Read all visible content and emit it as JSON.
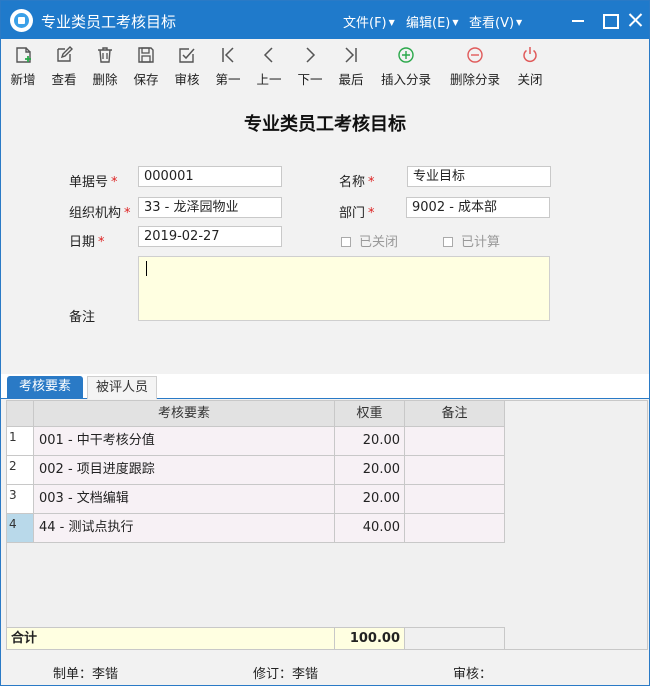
{
  "window": {
    "title": "专业类员工考核目标"
  },
  "menus": [
    {
      "label": "文件(F)"
    },
    {
      "label": "编辑(E)"
    },
    {
      "label": "查看(V)"
    }
  ],
  "toolbar": [
    {
      "label": "新增",
      "icon": "add-doc-icon"
    },
    {
      "label": "查看",
      "icon": "edit-icon"
    },
    {
      "label": "删除",
      "icon": "trash-icon"
    },
    {
      "label": "保存",
      "icon": "save-icon"
    },
    {
      "label": "审核",
      "icon": "approve-icon"
    },
    {
      "label": "第一",
      "icon": "first-icon"
    },
    {
      "label": "上一",
      "icon": "prev-icon"
    },
    {
      "label": "下一",
      "icon": "next-icon"
    },
    {
      "label": "最后",
      "icon": "last-icon"
    },
    {
      "label": "插入分录",
      "icon": "plus-circle-icon"
    },
    {
      "label": "删除分录",
      "icon": "minus-circle-icon"
    },
    {
      "label": "关闭",
      "icon": "power-icon"
    }
  ],
  "colors": {
    "accent": "#1f7acb",
    "add": "#2aa84a",
    "delete": "#e05a5a",
    "required": "#dd2222",
    "remark_bg": "#ffffe1"
  },
  "doc_title": "专业类员工考核目标",
  "form": {
    "doc_no": {
      "label": "单据号",
      "value": "000001"
    },
    "name": {
      "label": "名称",
      "value": "专业目标"
    },
    "org": {
      "label": "组织机构",
      "value": "33 - 龙泽园物业"
    },
    "dept": {
      "label": "部门",
      "value": "9002 - 成本部"
    },
    "date": {
      "label": "日期",
      "value": "2019-02-27"
    },
    "closed": {
      "label": "已关闭"
    },
    "calculated": {
      "label": "已计算"
    },
    "remark": {
      "label": "备注",
      "value": ""
    },
    "required_mark": "*"
  },
  "tabs": [
    {
      "label": "考核要素"
    },
    {
      "label": "被评人员"
    }
  ],
  "grid": {
    "columns": [
      "考核要素",
      "权重",
      "备注"
    ],
    "rows": [
      {
        "no": "1",
        "item": "001 - 中干考核分值",
        "weight": "20.00",
        "note": ""
      },
      {
        "no": "2",
        "item": "002 - 项目进度跟踪",
        "weight": "20.00",
        "note": ""
      },
      {
        "no": "3",
        "item": "003 - 文档编辑",
        "weight": "20.00",
        "note": ""
      },
      {
        "no": "4",
        "item": "44 - 测试点执行",
        "weight": "40.00",
        "note": ""
      }
    ],
    "total_label": "合计",
    "total_weight": "100.00"
  },
  "footer": {
    "maker": "制单：李锴",
    "reviser": "修订：李锴",
    "auditor": "审核："
  }
}
